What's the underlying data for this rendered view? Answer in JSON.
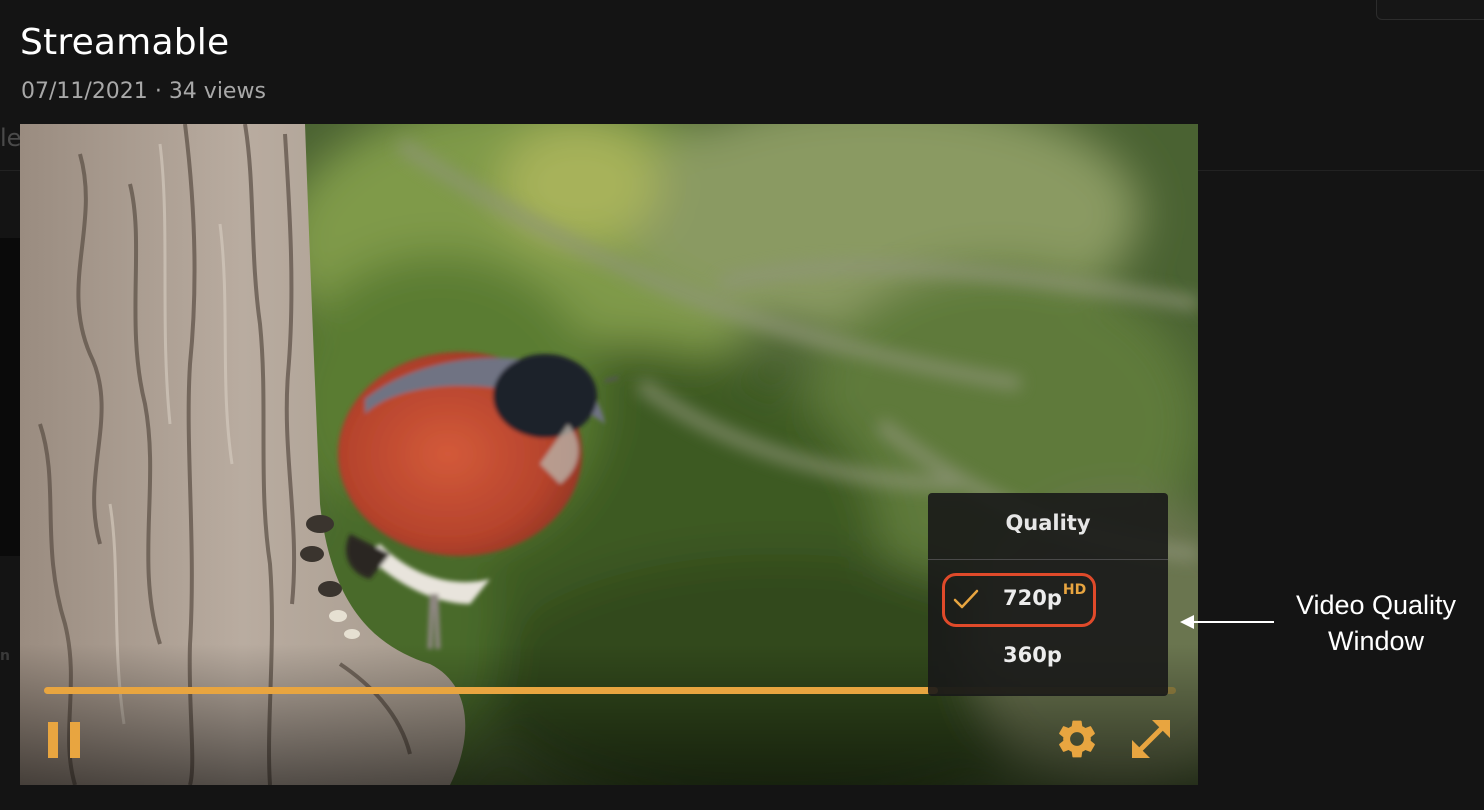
{
  "page": {
    "title": "Streamable",
    "date": "07/11/2021",
    "separator": "·",
    "views": "34 views"
  },
  "background": {
    "corner_text": "",
    "left_partial_char": "le",
    "left_partial_char2": "n"
  },
  "player": {
    "progress_fraction": 0.79,
    "accent_color": "#e8a540",
    "controls": {
      "pause_icon": "pause-icon",
      "settings_icon": "gear-icon",
      "fullscreen_icon": "fullscreen-icon"
    },
    "quality_menu": {
      "title": "Quality",
      "options": [
        {
          "label": "720p",
          "badge": "HD",
          "selected": true
        },
        {
          "label": "360p",
          "badge": "",
          "selected": false
        }
      ]
    }
  },
  "annotation": {
    "line1": "Video Quality",
    "line2": "Window",
    "highlight_color": "#e04a2a"
  }
}
